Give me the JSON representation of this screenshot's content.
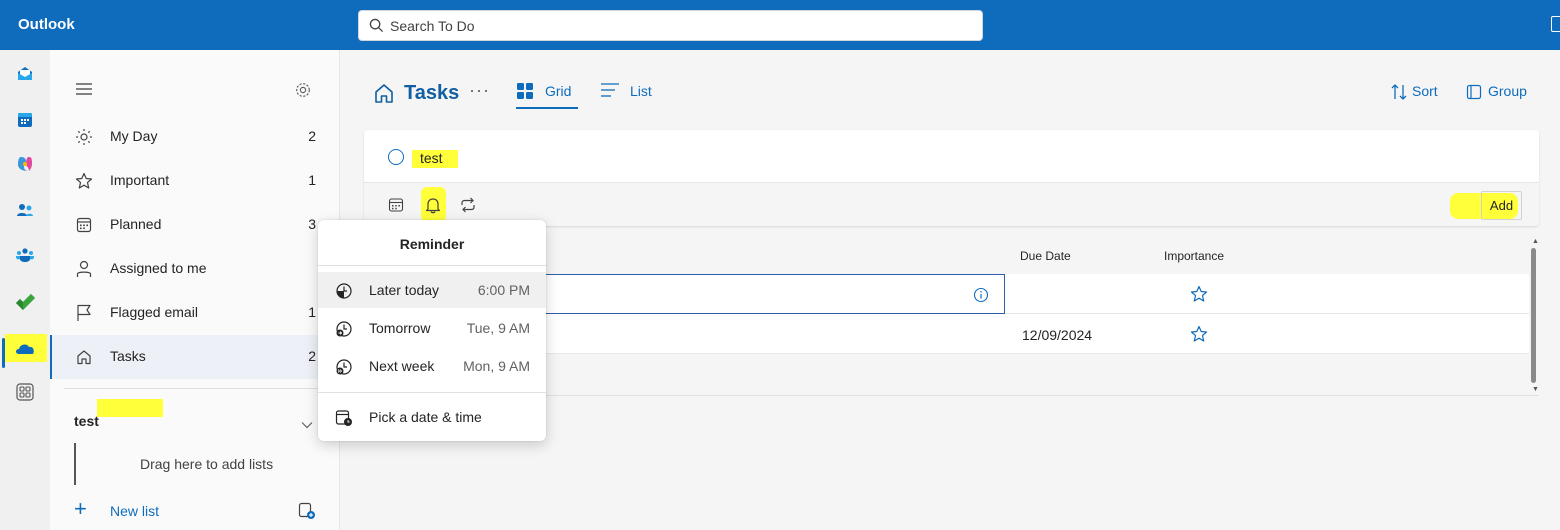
{
  "app": {
    "title": "Outlook"
  },
  "search": {
    "placeholder": "Search To Do"
  },
  "rail": {
    "items": [
      "mail-icon",
      "calendar-icon",
      "copilot-icon",
      "people-icon",
      "teams-icon",
      "todo-icon",
      "onedrive-icon",
      "apps-icon"
    ]
  },
  "sidebar": {
    "items": [
      {
        "label": "My Day",
        "count": "2",
        "icon": "sun-icon"
      },
      {
        "label": "Important",
        "count": "1",
        "icon": "star-icon"
      },
      {
        "label": "Planned",
        "count": "3",
        "icon": "calendar-icon"
      },
      {
        "label": "Assigned to me",
        "count": "",
        "icon": "person-icon"
      },
      {
        "label": "Flagged email",
        "count": "1",
        "icon": "flag-icon"
      },
      {
        "label": "Tasks",
        "count": "2",
        "icon": "home-icon"
      }
    ],
    "group": {
      "name": "test",
      "drop_hint": "Drag here to add lists"
    },
    "new_list": "New list"
  },
  "main": {
    "title": "Tasks",
    "more": "···",
    "tabs": [
      {
        "label": "Grid"
      },
      {
        "label": "List"
      }
    ],
    "sort": "Sort",
    "group": "Group"
  },
  "add_task": {
    "value": "test",
    "add_button": "Add"
  },
  "table": {
    "columns": [
      "Due Date",
      "Importance"
    ],
    "rows": [
      {
        "title": "",
        "due": ""
      },
      {
        "title": "",
        "due": "12/09/2024"
      }
    ]
  },
  "reminder": {
    "title": "Reminder",
    "options": [
      {
        "label": "Later today",
        "time": "6:00 PM"
      },
      {
        "label": "Tomorrow",
        "time": "Tue, 9 AM"
      },
      {
        "label": "Next week",
        "time": "Mon, 9 AM"
      }
    ],
    "custom": "Pick a date & time"
  },
  "colors": {
    "brand": "#0f6cbd",
    "highlight": "#ffff3a"
  }
}
